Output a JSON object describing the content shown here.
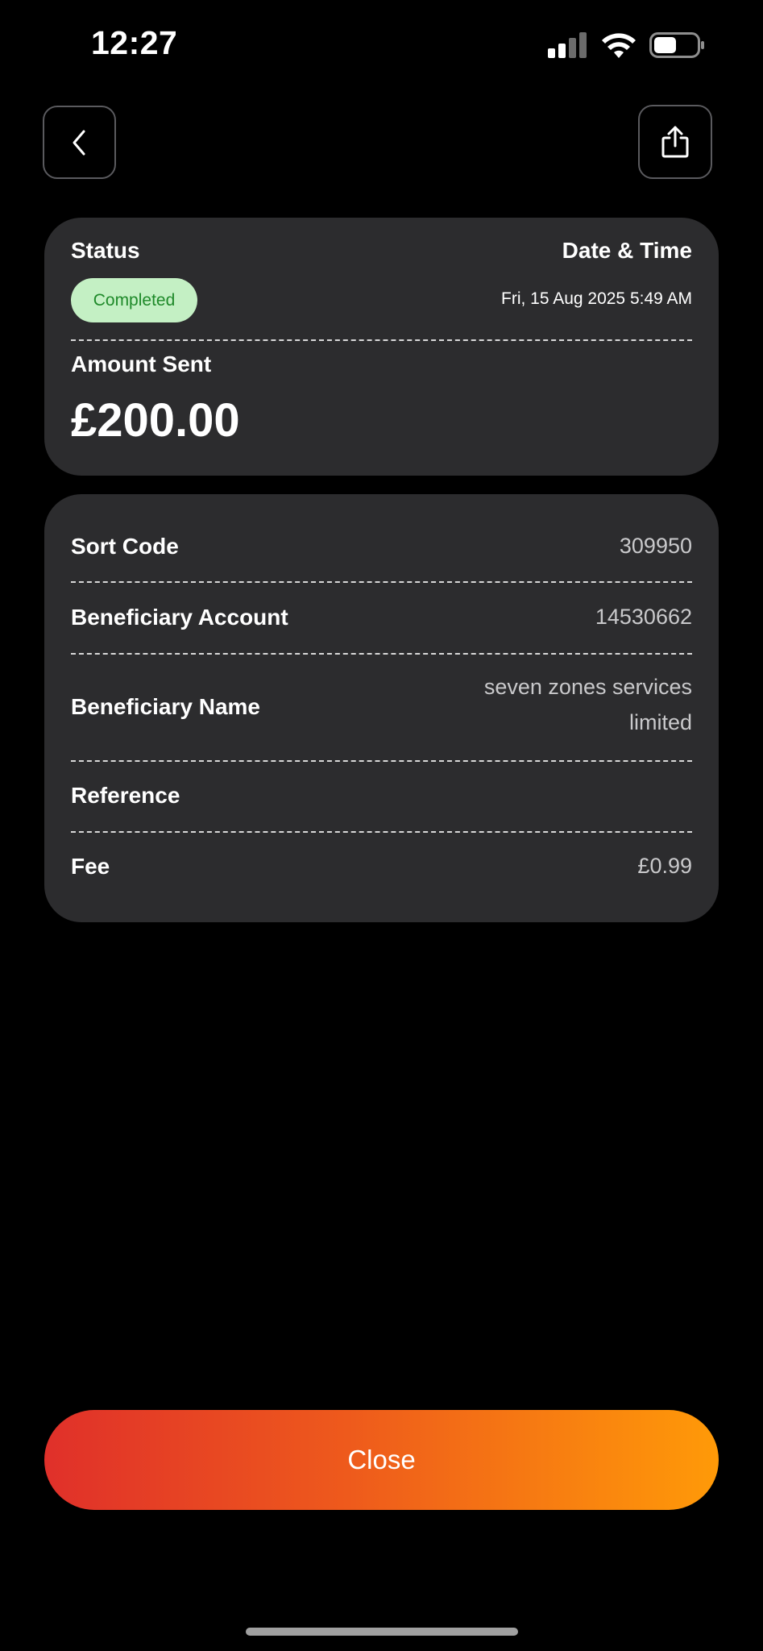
{
  "status_bar": {
    "time": "12:27",
    "icons": [
      "cellular-signal-icon",
      "wifi-icon",
      "battery-icon"
    ]
  },
  "header": {
    "back_icon": "chevron-left-icon",
    "share_icon": "share-icon"
  },
  "summary": {
    "status_label": "Status",
    "status_value": "Completed",
    "datetime_label": "Date & Time",
    "datetime_value": "Fri, 15 Aug 2025 5:49 AM",
    "amount_label": "Amount Sent",
    "amount_value": "£200.00"
  },
  "details": {
    "sort_code_label": "Sort Code",
    "sort_code_value": "309950",
    "account_label": "Beneficiary Account",
    "account_value": "14530662",
    "name_label": "Beneficiary Name",
    "name_value_line1": "seven zones services",
    "name_value_line2": "limited",
    "reference_label": "Reference",
    "reference_value": "",
    "fee_label": "Fee",
    "fee_value": "£0.99"
  },
  "footer": {
    "close_label": "Close"
  },
  "colors": {
    "background": "#000000",
    "card": "#2c2c2e",
    "badge_bg": "#c4f0c4",
    "badge_text": "#1f8a2a",
    "gradient_start": "#e0302a",
    "gradient_end": "#ff9a08"
  }
}
